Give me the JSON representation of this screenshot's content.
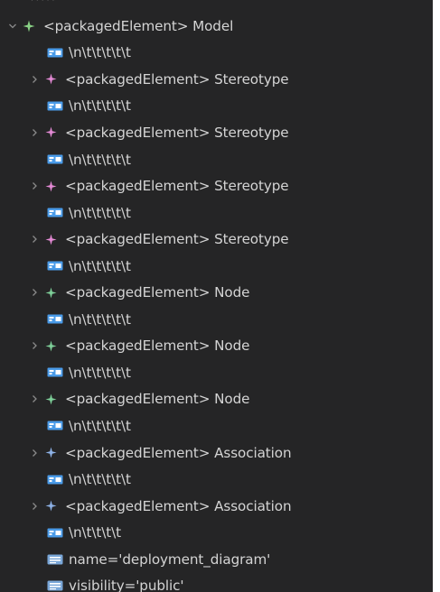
{
  "colors": {
    "background": "#252526",
    "text": "#d4d4d4",
    "twistie": "#8a8a8a",
    "model_star": "#89d185",
    "stereotype_star": "#e58bd6",
    "node_star": "#7fd19a",
    "association_star": "#8fb3e8",
    "text_node_icon": "#4a9be8",
    "attribute_icon": "#7aa7d8"
  },
  "tree": {
    "root": {
      "label": "<packagedElement> Model",
      "icon": "star-icon",
      "expanded": true
    },
    "items": [
      {
        "type": "text",
        "label": "\\n\\t\\t\\t\\t\\t"
      },
      {
        "type": "element",
        "label": "<packagedElement> Stereotype",
        "kind": "stereotype",
        "expanded": false
      },
      {
        "type": "text",
        "label": "\\n\\t\\t\\t\\t\\t"
      },
      {
        "type": "element",
        "label": "<packagedElement> Stereotype",
        "kind": "stereotype",
        "expanded": false
      },
      {
        "type": "text",
        "label": "\\n\\t\\t\\t\\t\\t"
      },
      {
        "type": "element",
        "label": "<packagedElement> Stereotype",
        "kind": "stereotype",
        "expanded": false
      },
      {
        "type": "text",
        "label": "\\n\\t\\t\\t\\t\\t"
      },
      {
        "type": "element",
        "label": "<packagedElement> Stereotype",
        "kind": "stereotype",
        "expanded": false
      },
      {
        "type": "text",
        "label": "\\n\\t\\t\\t\\t\\t"
      },
      {
        "type": "element",
        "label": "<packagedElement> Node",
        "kind": "node",
        "expanded": false
      },
      {
        "type": "text",
        "label": "\\n\\t\\t\\t\\t\\t"
      },
      {
        "type": "element",
        "label": "<packagedElement> Node",
        "kind": "node",
        "expanded": false
      },
      {
        "type": "text",
        "label": "\\n\\t\\t\\t\\t\\t"
      },
      {
        "type": "element",
        "label": "<packagedElement> Node",
        "kind": "node",
        "expanded": false
      },
      {
        "type": "text",
        "label": "\\n\\t\\t\\t\\t\\t"
      },
      {
        "type": "element",
        "label": "<packagedElement> Association",
        "kind": "association",
        "expanded": false
      },
      {
        "type": "text",
        "label": "\\n\\t\\t\\t\\t\\t"
      },
      {
        "type": "element",
        "label": "<packagedElement> Association",
        "kind": "association",
        "expanded": false
      },
      {
        "type": "text",
        "label": "\\n\\t\\t\\t\\t"
      },
      {
        "type": "attribute",
        "label": "name='deployment_diagram'"
      },
      {
        "type": "attribute",
        "label": "visibility='public'"
      }
    ]
  }
}
